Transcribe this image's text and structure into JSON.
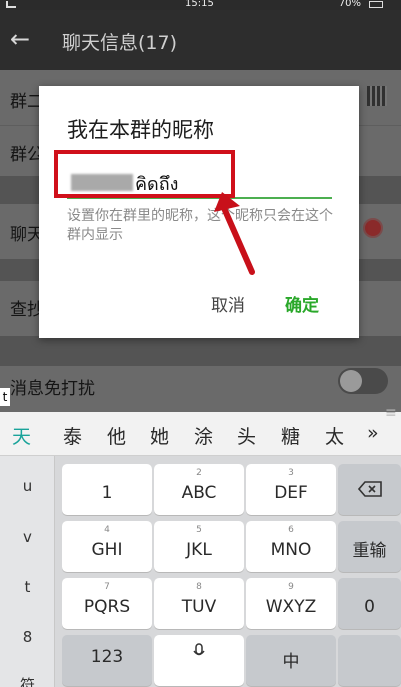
{
  "status": {
    "time": "15:15",
    "battery": "70%"
  },
  "appbar": {
    "title": "聊天信息(17)",
    "back_icon": "arrow-left-icon"
  },
  "list": {
    "row_group_name": "群二",
    "row_group_notice": "群公",
    "row_chat": "聊天",
    "row_find": "查抄",
    "row_mute": "消息免打扰"
  },
  "dialog": {
    "title": "我在本群的昵称",
    "nickname_value": "คิดถึง",
    "hint": "设置你在群里的昵称，这个昵称只会在这个群内显示",
    "cancel_label": "取消",
    "confirm_label": "确定",
    "accent_color": "#4caf50"
  },
  "annotation": {
    "color": "#d0101a"
  },
  "keyboard": {
    "suggestions": [
      "天",
      "泰",
      "他",
      "她",
      "涂",
      "头",
      "糖",
      "太",
      "»"
    ],
    "left_column": [
      "u",
      "v",
      "t",
      "8",
      "符"
    ],
    "keys": [
      {
        "sub": "1",
        "main": ""
      },
      {
        "sub": "",
        "main": "1"
      },
      {
        "sub": "2",
        "main": "ABC"
      },
      {
        "sub": "3",
        "main": "DEF"
      },
      {
        "sub": "4",
        "main": "GHI"
      },
      {
        "sub": "5",
        "main": "JKL"
      },
      {
        "sub": "6",
        "main": "MNO"
      },
      {
        "sub": "7",
        "main": "PQRS"
      },
      {
        "sub": "8",
        "main": "TUV"
      },
      {
        "sub": "9",
        "main": "WXYZ"
      }
    ],
    "func_repeat": "重输",
    "func_zero": "0",
    "bottom_123": "123",
    "bottom_zh": "中",
    "side_t": "t"
  }
}
